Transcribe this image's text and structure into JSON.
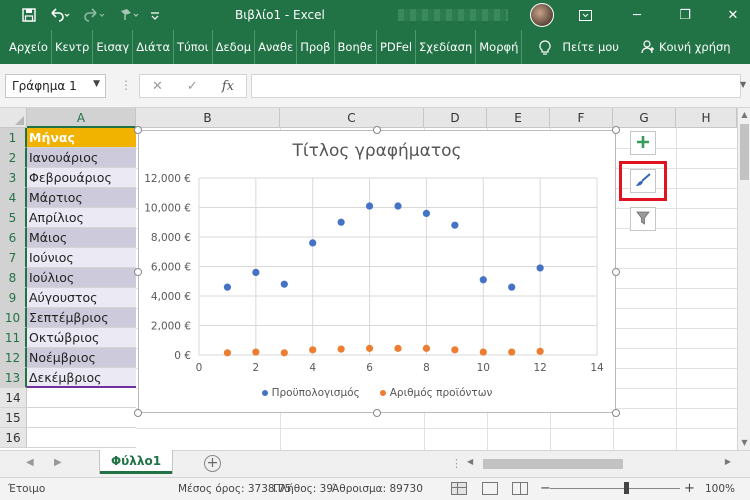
{
  "window": {
    "title": "Βιβλίο1 - Excel",
    "minimize": "─",
    "restore": "❐",
    "close": "✕"
  },
  "quick_access": {
    "save_icon": "save-icon",
    "undo_icon": "undo-icon",
    "redo_icon": "redo-icon",
    "format_icon": "format-painter-icon"
  },
  "ribbon": {
    "tabs": [
      "Αρχείο",
      "Κεντρ",
      "Εισαγ",
      "Διάτα",
      "Τύποι",
      "Δεδομ",
      "Αναθε",
      "Προβ",
      "Βοηθε",
      "PDFel",
      "Σχεδίαση",
      "Μορφή"
    ],
    "tell_me": "Πείτε μου",
    "share": "Κοινή χρήση"
  },
  "formula_bar": {
    "name_box": "Γράφημα 1",
    "cancel": "✕",
    "enter": "✓",
    "fx": "fx",
    "value": ""
  },
  "columns": [
    "A",
    "B",
    "C",
    "D",
    "E",
    "F",
    "G",
    "H"
  ],
  "rows": [
    "1",
    "2",
    "3",
    "4",
    "5",
    "6",
    "7",
    "8",
    "9",
    "10",
    "11",
    "12",
    "13",
    "14",
    "15",
    "16"
  ],
  "column_a": [
    "Μήνας",
    "Ιανουάριος",
    "Φεβρουάριος",
    "Μάρτιος",
    "Απρίλιος",
    "Μάιος",
    "Ιούνιος",
    "Ιούλιος",
    "Αύγουστος",
    "Σεπτέμβριος",
    "Οκτώβριος",
    "Νοέμβριος",
    "Δεκέμβριος"
  ],
  "chart_data": {
    "type": "scatter",
    "title": "Τίτλος γραφήματος",
    "xlim": [
      0,
      14
    ],
    "ylim": [
      0,
      12000
    ],
    "x_ticks": [
      "0",
      "2",
      "4",
      "6",
      "8",
      "10",
      "12",
      "14"
    ],
    "y_ticks": [
      "0 €",
      "2,000 €",
      "4,000 €",
      "6,000 €",
      "8,000 €",
      "10,000 €",
      "12,000 €"
    ],
    "grid": true,
    "legend_position": "bottom",
    "series": [
      {
        "name": "Προϋπολογισμός",
        "color": "#4472c4",
        "x": [
          1,
          2,
          3,
          4,
          5,
          6,
          7,
          8,
          9,
          10,
          11,
          12
        ],
        "y": [
          4600,
          5600,
          4800,
          7600,
          9000,
          10100,
          10100,
          9600,
          8800,
          5100,
          4600,
          5900
        ]
      },
      {
        "name": "Αριθμός προϊόντων",
        "color": "#ed7d31",
        "x": [
          1,
          2,
          3,
          4,
          5,
          6,
          7,
          8,
          9,
          10,
          11,
          12
        ],
        "y": [
          150,
          200,
          150,
          350,
          400,
          450,
          450,
          450,
          350,
          200,
          200,
          250
        ]
      }
    ]
  },
  "chart_buttons": {
    "elements_icon": "plus-icon",
    "styles_icon": "brush-icon",
    "filters_icon": "filter-icon"
  },
  "sheet_tabs": {
    "active": "Φύλλο1",
    "add": "+"
  },
  "status": {
    "ready": "Έτοιμο",
    "average": "Μέσος όρος: 3738.75",
    "count": "Πλήθος: 39",
    "sum": "Άθροισμα: 89730",
    "zoom": "100%",
    "zoom_out": "−",
    "zoom_in": "+"
  }
}
